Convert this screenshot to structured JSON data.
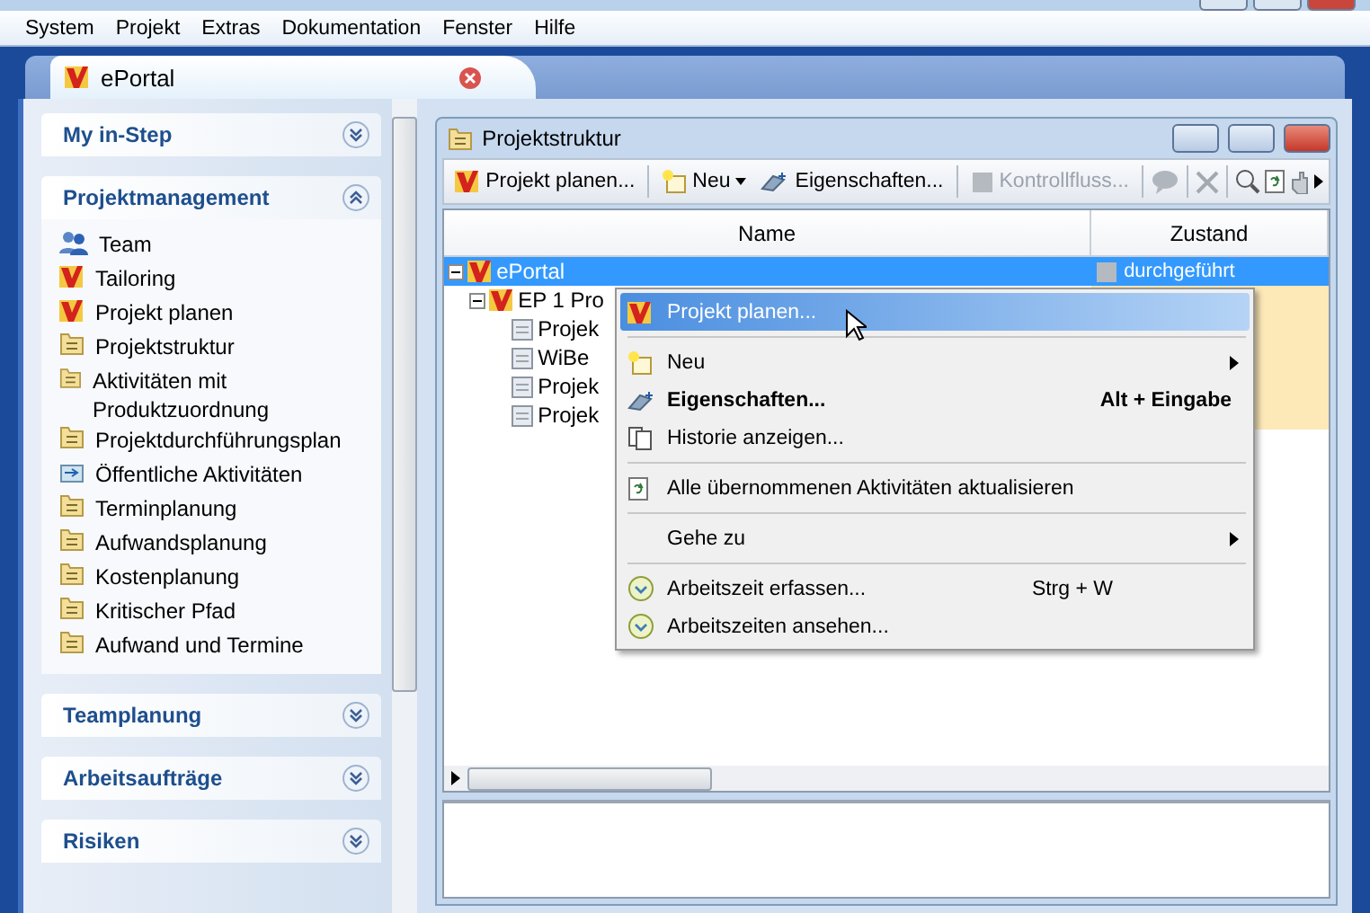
{
  "menu_bar": [
    "System",
    "Projekt",
    "Extras",
    "Dokumentation",
    "Fenster",
    "Hilfe"
  ],
  "tab": {
    "label": "ePortal",
    "selected": true
  },
  "sidebar": {
    "sections": [
      {
        "title": "My in-Step",
        "expanded": false
      },
      {
        "title": "Projektmanagement",
        "expanded": true,
        "items": [
          "Team",
          "Tailoring",
          "Projekt planen",
          "Projektstruktur",
          "Aktivitäten mit Produktzuordnung",
          "Projektdurchführungsplan",
          "Öffentliche Aktivitäten",
          "Terminplanung",
          "Aufwandsplanung",
          "Kostenplanung",
          "Kritischer Pfad",
          "Aufwand und Termine"
        ]
      },
      {
        "title": "Teamplanung",
        "expanded": false
      },
      {
        "title": "Arbeitsaufträge",
        "expanded": false
      },
      {
        "title": "Risiken",
        "expanded": false
      }
    ]
  },
  "window": {
    "title": "Projektstruktur",
    "toolbar": [
      {
        "label": "Projekt planen...",
        "disabled": false,
        "dropdown": false
      },
      {
        "label": "Neu",
        "disabled": false,
        "dropdown": true
      },
      {
        "label": "Eigenschaften...",
        "disabled": false,
        "dropdown": false
      },
      {
        "label": "Kontrollfluss...",
        "disabled": true,
        "dropdown": false
      }
    ],
    "table": {
      "columns": [
        "Name",
        "Zustand"
      ],
      "rows": [
        {
          "name": "ePortal",
          "zustand": "durchgeführt",
          "selected": true,
          "expanded": true,
          "children": [
            {
              "name": "EP 1 Pro",
              "selected": false,
              "expanded": true,
              "children": [
                {
                  "name": "Projek",
                  "selected": false
                },
                {
                  "name": "WiBe",
                  "selected": false
                },
                {
                  "name": "Projek",
                  "selected": false
                },
                {
                  "name": "Projek",
                  "selected": false
                }
              ]
            }
          ]
        }
      ]
    }
  },
  "context_menu": [
    {
      "kind": "item",
      "label": "Projekt planen...",
      "selected": true
    },
    {
      "kind": "separator"
    },
    {
      "kind": "item",
      "label": "Neu",
      "submenu": true,
      "selected": false
    },
    {
      "kind": "item",
      "label": "Eigenschaften...",
      "shortcut": "Alt + Eingabe",
      "default": true,
      "selected": false
    },
    {
      "kind": "item",
      "label": "Historie anzeigen...",
      "selected": false
    },
    {
      "kind": "separator"
    },
    {
      "kind": "item",
      "label": "Alle übernommenen Aktivitäten aktualisieren",
      "selected": false
    },
    {
      "kind": "separator"
    },
    {
      "kind": "item",
      "label": "Gehe zu",
      "submenu": true,
      "selected": false
    },
    {
      "kind": "separator"
    },
    {
      "kind": "item",
      "label": "Arbeitszeit erfassen...",
      "shortcut": "Strg + W",
      "selected": false
    },
    {
      "kind": "item",
      "label": "Arbeitszeiten ansehen...",
      "selected": false
    }
  ]
}
